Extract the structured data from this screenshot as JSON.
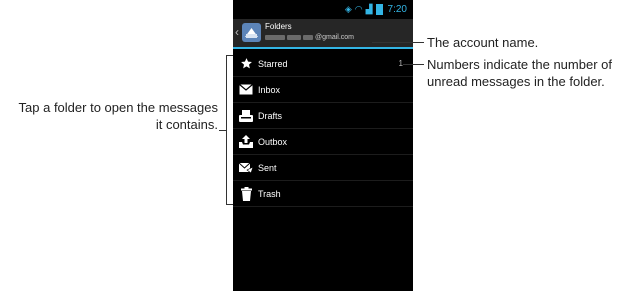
{
  "status_bar": {
    "time": "7:20"
  },
  "action_bar": {
    "title": "Folders",
    "account_suffix": "@gmail.com"
  },
  "folders": [
    {
      "label": "Starred",
      "icon": "star-icon",
      "count": "1"
    },
    {
      "label": "Inbox",
      "icon": "envelope-icon",
      "count": ""
    },
    {
      "label": "Drafts",
      "icon": "drafts-icon",
      "count": ""
    },
    {
      "label": "Outbox",
      "icon": "outbox-icon",
      "count": ""
    },
    {
      "label": "Sent",
      "icon": "sent-icon",
      "count": ""
    },
    {
      "label": "Trash",
      "icon": "trash-icon",
      "count": ""
    }
  ],
  "annotations": {
    "left_line1": "Tap a folder to open the messages",
    "left_line2": "it contains.",
    "account": "The account name.",
    "unread_line1": "Numbers indicate the number of",
    "unread_line2": "unread messages in the folder."
  },
  "colors": {
    "accent": "#33b5e5",
    "background": "#000000",
    "actionbar": "#262626"
  }
}
